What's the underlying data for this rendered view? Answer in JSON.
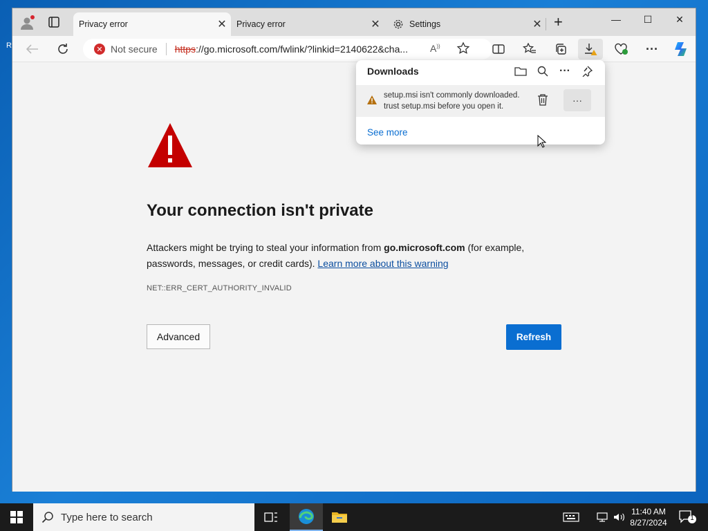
{
  "desktop": {
    "edge_letter": "R"
  },
  "tabs": [
    {
      "label": "Privacy error",
      "active": true
    },
    {
      "label": "Privacy error",
      "active": false
    },
    {
      "label": "Settings",
      "active": false
    }
  ],
  "addressbar": {
    "security_label": "Not secure",
    "scheme": "https",
    "url_rest": "://go.microsoft.com/fwlink/?linkid=2140622&cha..."
  },
  "downloads": {
    "title": "Downloads",
    "item_line1": "setup.msi isn't commonly downloaded.",
    "item_line2": "trust setup.msi before you open it.",
    "more_label": "···",
    "see_more": "See more"
  },
  "page": {
    "heading": "Your connection isn't private",
    "para_pre": "Attackers might be trying to steal your information from ",
    "para_domain": "go.microsoft.com",
    "para_mid": " (for example, passwords, messages, or credit cards). ",
    "para_link": "Learn more about this warning",
    "error_code": "NET::ERR_CERT_AUTHORITY_INVALID",
    "advanced_label": "Advanced",
    "refresh_label": "Refresh"
  },
  "taskbar": {
    "search_placeholder": "Type here to search",
    "time": "11:40 AM",
    "date": "8/27/2024",
    "notification_count": "1"
  },
  "colors": {
    "refresh_button": "#0a6ed1",
    "warning_red": "#c40000",
    "not_secure_red": "#d12c2c"
  }
}
